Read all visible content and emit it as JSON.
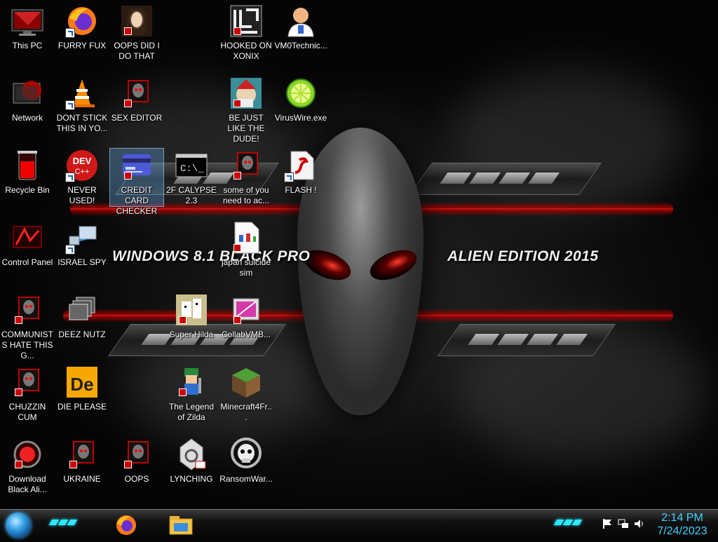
{
  "banner": {
    "left": "WINDOWS 8.1 BLACK PRO",
    "right": "ALIEN EDITION 2015"
  },
  "icons": [
    {
      "name": "this-pc-icon",
      "label": "This PC"
    },
    {
      "name": "firefox-icon",
      "label": "FURRY FUX"
    },
    {
      "name": "portrait-icon",
      "label": "OOPS DID I DO THAT"
    },
    {
      "name": "maze-icon",
      "label": "HOOKED ON XONIX"
    },
    {
      "name": "doctor-icon",
      "label": "VM0Technic..."
    },
    {
      "name": "network-icon",
      "label": "Network"
    },
    {
      "name": "vlc-cone-icon",
      "label": "DONT STICK THIS IN YO..."
    },
    {
      "name": "alien-head-icon",
      "label": "SEX EDITOR"
    },
    {
      "name": "elf-game-icon",
      "label": "BE JUST LIKE THE DUDE!"
    },
    {
      "name": "lime-icon",
      "label": "VirusWire.exe"
    },
    {
      "name": "recycle-bin-icon",
      "label": "Recycle Bin"
    },
    {
      "name": "dev-cpp-icon",
      "label": "NEVER USED!"
    },
    {
      "name": "credit-card-icon",
      "label": "CREDIT CARD CHECKER"
    },
    {
      "name": "terminal-icon",
      "label": "2F CALYPSE 2.3"
    },
    {
      "name": "alien-head-icon",
      "label": "some of you need to ac..."
    },
    {
      "name": "flash-file-icon",
      "label": "FLASH !"
    },
    {
      "name": "control-panel-icon",
      "label": "Control Panel"
    },
    {
      "name": "network-devices-icon",
      "label": "ISRAEL SPY"
    },
    {
      "name": "document-icon",
      "label": "japan suicide sim"
    },
    {
      "name": "alien-head-icon",
      "label": "COMMUNISTS HATE THIS G..."
    },
    {
      "name": "windows-stack-icon",
      "label": "DEEZ NUTZ"
    },
    {
      "name": "pixel-dog-icon",
      "label": "Super Hilda"
    },
    {
      "name": "collab-vm-icon",
      "label": "CollabVMB..."
    },
    {
      "name": "alien-head-icon",
      "label": "CHUZZIN CUM"
    },
    {
      "name": "die-icon",
      "label": "DIE PLEASE"
    },
    {
      "name": "zelda-icon",
      "label": "The Legend of Zilda"
    },
    {
      "name": "minecraft-icon",
      "label": "Minecraft4Fr..."
    },
    {
      "name": "alien-orb-icon",
      "label": "Download Black Ali..."
    },
    {
      "name": "alien-head-icon",
      "label": "UKRAINE"
    },
    {
      "name": "alien-head-icon",
      "label": "OOPS"
    },
    {
      "name": "noose-icon",
      "label": "LYNCHING"
    },
    {
      "name": "skull-icon",
      "label": "RansomWar..."
    }
  ],
  "taskbar": {
    "pinned": [
      {
        "name": "firefox-taskbar-icon"
      },
      {
        "name": "file-explorer-taskbar-icon"
      }
    ],
    "tray": [
      "flag-icon",
      "network-tray-icon",
      "volume-icon"
    ],
    "time": "2:14 PM",
    "date": "7/24/2023"
  },
  "colors": {
    "accent": "#3fd2ff",
    "wallpaper_red": "#ff2a1a"
  }
}
